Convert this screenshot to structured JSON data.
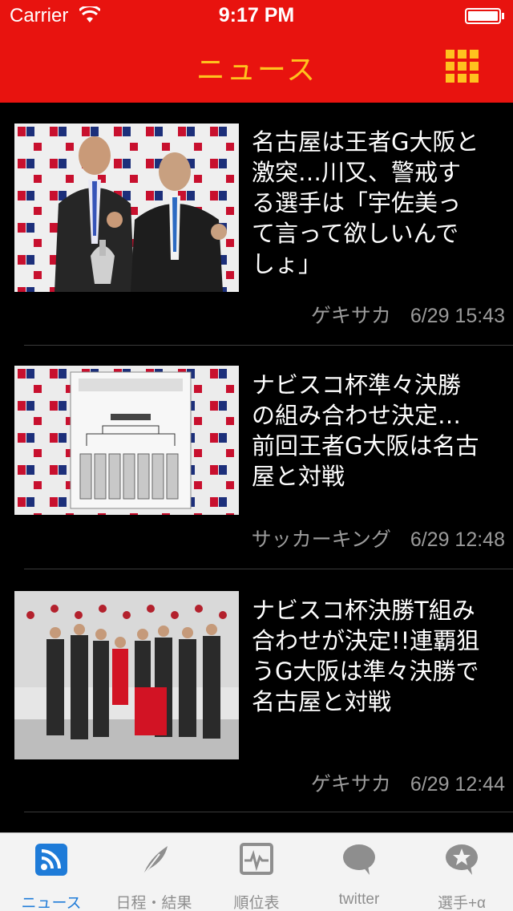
{
  "status_bar": {
    "carrier": "Carrier",
    "time": "9:17 PM"
  },
  "nav": {
    "title": "ニュース",
    "menu_icon": "grid-menu-icon",
    "accent_color": "#e8130f",
    "title_color": "#ffc21e"
  },
  "news": [
    {
      "headline_lines": [
        "名古屋は王者G大阪と",
        "激突…川又、警戒す",
        "る選手は「宇佐美っ",
        "て言って欲しいんで",
        "しょ」"
      ],
      "source": "ゲキサカ",
      "datetime": "6/29 15:43"
    },
    {
      "headline_lines": [
        "ナビスコ杯準々決勝",
        "の組み合わせ決定…",
        "前回王者G大阪は名古",
        "屋と対戦"
      ],
      "source": "サッカーキング",
      "datetime": "6/29 12:48"
    },
    {
      "headline_lines": [
        "ナビスコ杯決勝T組み",
        "合わせが決定!!連覇狙",
        "うG大阪は準々決勝で",
        "名古屋と対戦"
      ],
      "source": "ゲキサカ",
      "datetime": "6/29 12:44"
    }
  ],
  "tabs": [
    {
      "label": "ニュース",
      "icon": "rss-icon",
      "active": true
    },
    {
      "label": "日程・結果",
      "icon": "quill-icon",
      "active": false
    },
    {
      "label": "順位表",
      "icon": "monitor-chart-icon",
      "active": false
    },
    {
      "label": "twitter",
      "icon": "speech-bubble-icon",
      "active": false
    },
    {
      "label": "選手+α",
      "icon": "star-bubble-icon",
      "active": false
    }
  ]
}
